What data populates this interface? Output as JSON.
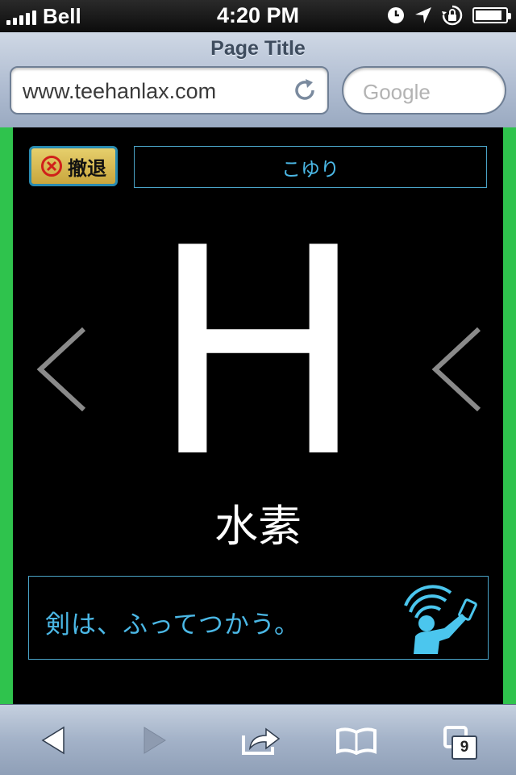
{
  "status_bar": {
    "carrier": "Bell",
    "time": "4:20 PM",
    "signal_bars": 5,
    "battery_level": 0.9,
    "icons": [
      "clock-icon",
      "location-arrow-icon",
      "rotation-lock-icon",
      "battery-icon"
    ]
  },
  "browser": {
    "page_title": "Page Title",
    "url": "www.teehanlax.com",
    "search_placeholder": "Google"
  },
  "app": {
    "retreat_label": "撤退",
    "player_name": "こゆり",
    "element_symbol": "H",
    "element_name": "水素",
    "slogan": "剣は、ふってつかう。",
    "accent_color": "#4bb8e6",
    "gutter_color": "#2fc34d"
  },
  "toolbar": {
    "tab_count": "9",
    "icons": [
      "back-arrow-icon",
      "forward-arrow-icon",
      "share-icon",
      "bookmarks-icon",
      "tabs-icon"
    ]
  }
}
